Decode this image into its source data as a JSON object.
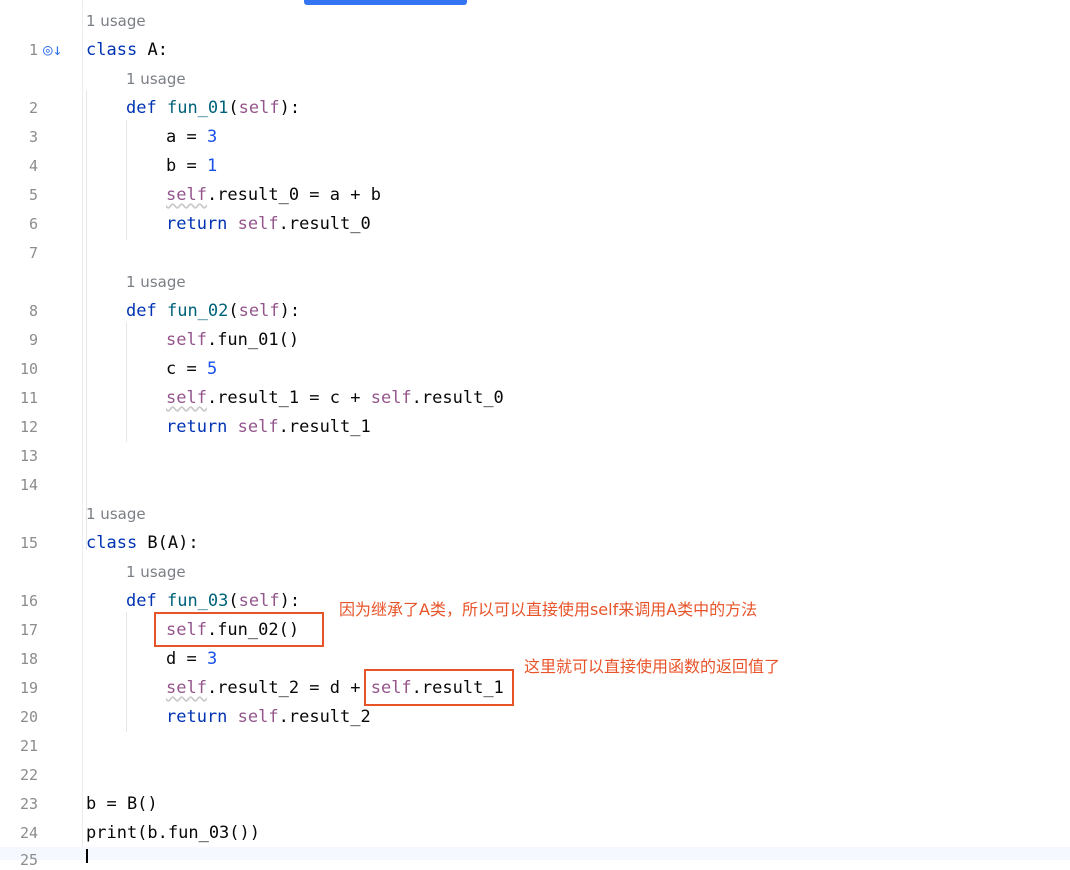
{
  "hints": [
    "1 usage",
    "1 usage",
    "1 usage",
    "1 usage",
    "1 usage"
  ],
  "line_numbers": [
    "1",
    "2",
    "3",
    "4",
    "5",
    "6",
    "7",
    "8",
    "9",
    "10",
    "11",
    "12",
    "13",
    "14",
    "15",
    "16",
    "17",
    "18",
    "19",
    "20",
    "21",
    "22",
    "23",
    "24",
    "25"
  ],
  "code": {
    "l1": [
      "class",
      " ",
      "A",
      ":"
    ],
    "l2": [
      "def",
      " ",
      "fun_01",
      "(",
      "self",
      "):"
    ],
    "l3": [
      "a = ",
      "3"
    ],
    "l4": [
      "b = ",
      "1"
    ],
    "l5": [
      "self",
      ".result_0 = a + b"
    ],
    "l6": [
      "return",
      " ",
      "self",
      ".result_0"
    ],
    "l8": [
      "def",
      " ",
      "fun_02",
      "(",
      "self",
      "):"
    ],
    "l9": [
      "self",
      ".fun_01()"
    ],
    "l10": [
      "c = ",
      "5"
    ],
    "l11": [
      "self",
      ".result_1 = c + ",
      "self",
      ".result_0"
    ],
    "l12": [
      "return",
      " ",
      "self",
      ".result_1"
    ],
    "l15": [
      "class",
      " B(A):"
    ],
    "l16": [
      "def",
      " ",
      "fun_03",
      "(",
      "self",
      "):"
    ],
    "l17": [
      "self",
      ".fun_02()"
    ],
    "l18": [
      "d = ",
      "3"
    ],
    "l19": [
      "self",
      ".result_2 = d + ",
      "self",
      ".result_1"
    ],
    "l20": [
      "return",
      " ",
      "self",
      ".result_2"
    ],
    "l23": [
      "b = B()"
    ],
    "l24": [
      "print(b.fun_03())"
    ]
  },
  "annotations": {
    "a1": "因为继承了A类，所以可以直接使用self来调用A类中的方法",
    "a2": "这里就可以直接使用函数的返回值了"
  },
  "icons": {
    "gutter": "implemented-method-icon"
  },
  "colors": {
    "keyword": "#0033b3",
    "function": "#00627a",
    "number": "#1750eb",
    "self": "#94558d",
    "annotation": "#e8542a",
    "tab_indicator": "#3574f0"
  }
}
